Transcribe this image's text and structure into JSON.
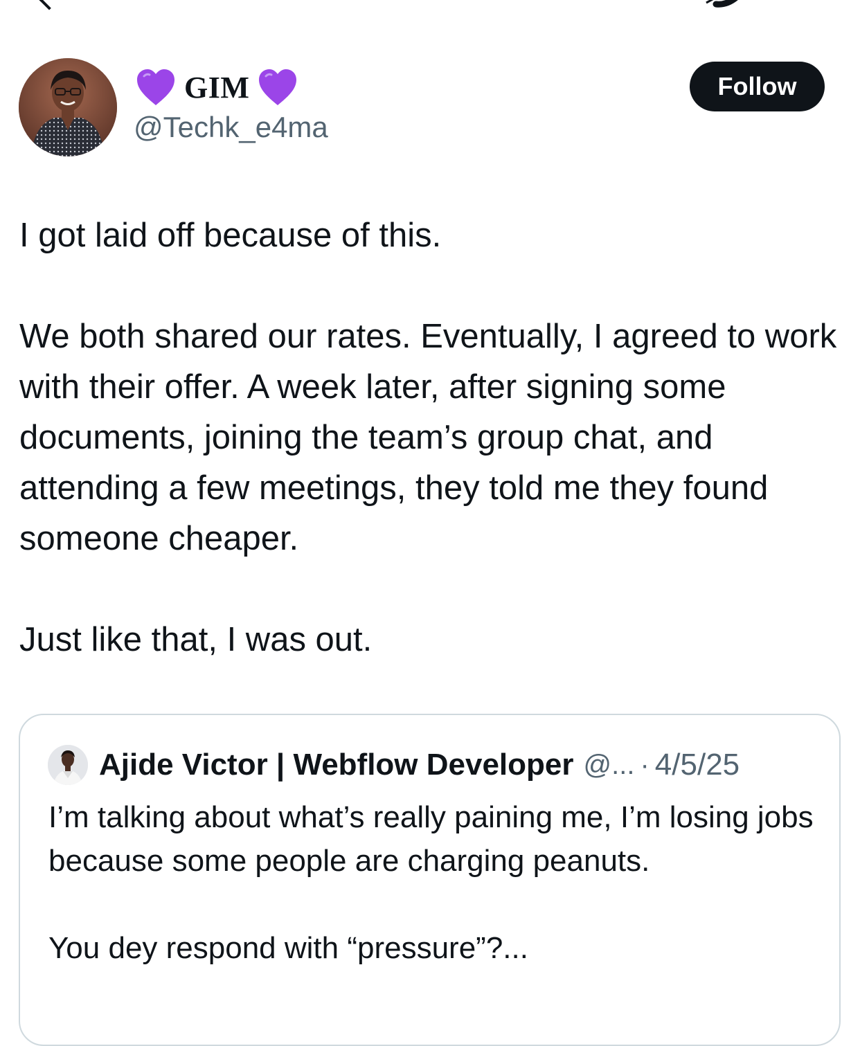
{
  "author": {
    "name": "GIM",
    "handle": "@Techk_e4ma",
    "name_emoji": "purple-heart-icon"
  },
  "follow_button": {
    "label": "Follow"
  },
  "tweet": {
    "paragraphs": [
      "I got laid off because of this.",
      "We both shared our rates. Eventually, I agreed to work with their offer. A week later, after signing some documents, joining the team’s group chat, and attending a few meetings, they told me they found someone cheaper.",
      "Just like that, I was out."
    ]
  },
  "quoted_tweet": {
    "author_name": "Ajide Victor | Webflow Developer",
    "handle": "@...",
    "separator": "·",
    "date": "4/5/25",
    "paragraphs": [
      "I’m talking about what’s really paining me, I’m losing jobs because some people are charging peanuts.",
      "You dey respond with “pressure”?..."
    ]
  },
  "colors": {
    "text_primary": "#0f1419",
    "text_secondary": "#536471",
    "button_bg": "#0f1419",
    "border": "#cfd9de",
    "heart": "#9b45e8"
  }
}
